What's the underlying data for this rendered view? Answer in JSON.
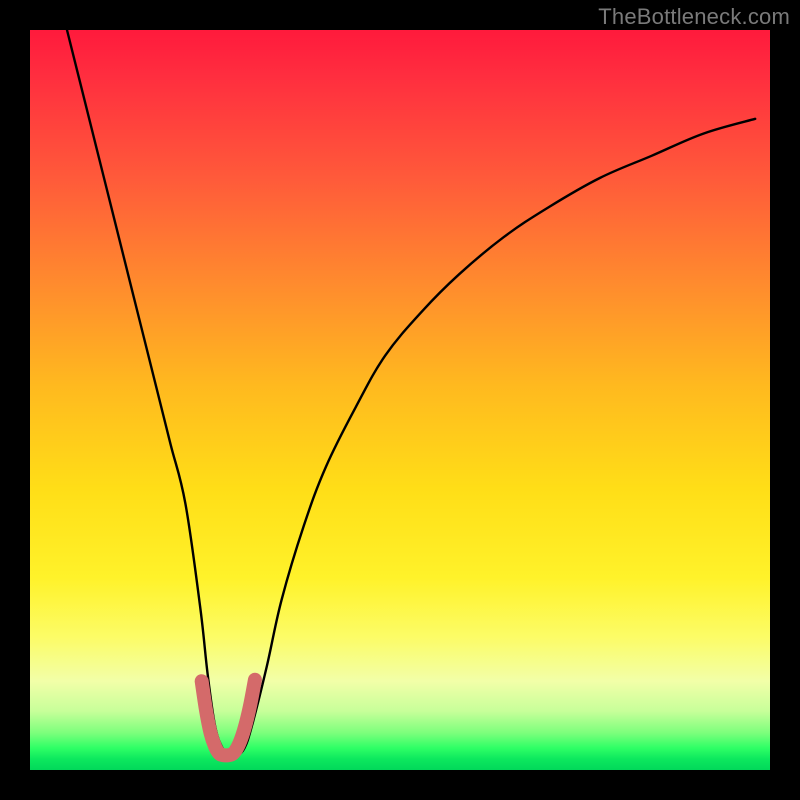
{
  "watermark": {
    "text": "TheBottleneck.com"
  },
  "chart_data": {
    "type": "line",
    "title": "",
    "xlabel": "",
    "ylabel": "",
    "xlim": [
      0,
      100
    ],
    "ylim": [
      0,
      100
    ],
    "grid": false,
    "legend": false,
    "series": [
      {
        "name": "bottleneck-curve",
        "color": "#000000",
        "x": [
          5,
          7,
          9,
          11,
          13,
          15,
          17,
          19,
          21,
          23,
          24,
          25,
          26,
          27,
          28,
          29,
          30,
          32,
          34,
          37,
          40,
          44,
          48,
          53,
          58,
          64,
          70,
          77,
          84,
          91,
          98
        ],
        "y": [
          100,
          92,
          84,
          76,
          68,
          60,
          52,
          44,
          36,
          22,
          13,
          6,
          3,
          2,
          2,
          3,
          6,
          14,
          23,
          33,
          41,
          49,
          56,
          62,
          67,
          72,
          76,
          80,
          83,
          86,
          88
        ]
      },
      {
        "name": "valley-highlight",
        "color": "#d46a6a",
        "x": [
          23.2,
          23.8,
          24.4,
          25.0,
          25.6,
          26.2,
          26.8,
          27.4,
          28.0,
          28.6,
          29.2,
          29.8,
          30.4
        ],
        "y": [
          12.0,
          8.0,
          5.0,
          3.2,
          2.2,
          2.0,
          2.0,
          2.2,
          3.0,
          4.4,
          6.4,
          9.0,
          12.2
        ]
      }
    ],
    "background_gradient_note": "Vertical gradient from red (top) through orange/yellow to green (bottom) representing bottleneck severity."
  }
}
